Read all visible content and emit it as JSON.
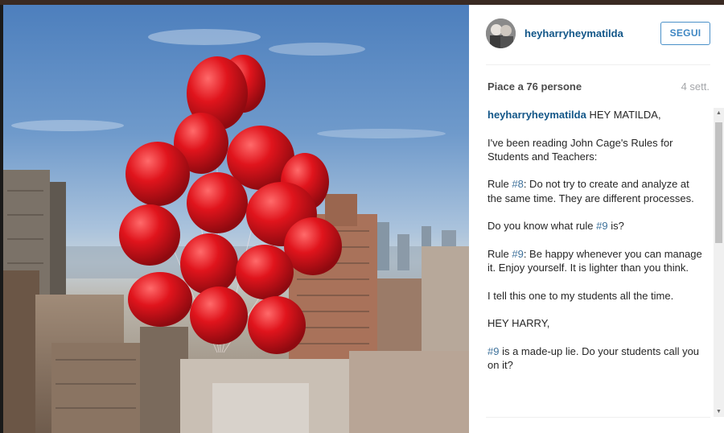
{
  "post": {
    "username": "heyharryheymatilda",
    "follow_label": "SEGUI",
    "likes_text": "Piace a 76 persone",
    "time_text": "4 sett.",
    "photo_icon": "red-balloons-photo",
    "caption": {
      "author": "heyharryheymatilda",
      "opening": "HEY MATILDA,",
      "p1": "I've been reading John Cage's Rules for Students and Teachers:",
      "p2_pre": "Rule ",
      "p2_tag": "#8",
      "p2_post": ": Do not try to create and analyze at the same time. They are different processes.",
      "p3": "Do you know what rule #9 is?",
      "p4_pre": "Rule ",
      "p4_tag": "#9",
      "p4_post": ": Be happy whenever you can manage it. Enjoy yourself. It is lighter than you think.",
      "p5": "I tell this one to my students all the time.",
      "p6": "HEY HARRY,",
      "p7_tag": "#9",
      "p7_post": " is a made-up lie. Do your students call you on it?"
    }
  },
  "colors": {
    "username": "#125688",
    "follow_border": "#4a90c8",
    "hashtag": "#3f729b",
    "balloon": "#d9131b"
  },
  "scrollbar": {
    "up_icon": "▲",
    "down_icon": "▼"
  }
}
